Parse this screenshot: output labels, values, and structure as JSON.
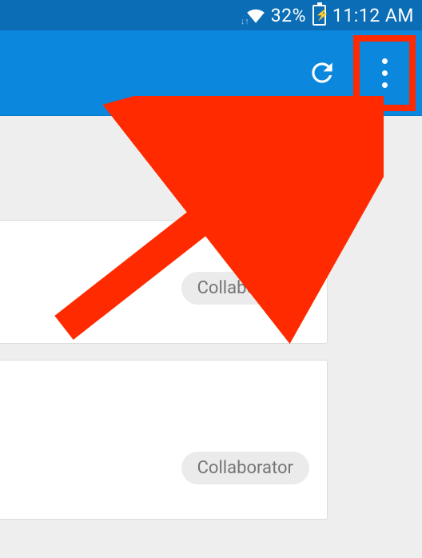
{
  "statusBar": {
    "batteryPercent": "32%",
    "time": "11:12 AM"
  },
  "cards": [
    {
      "badge": "Collaborator"
    },
    {
      "badge": "Collaborator"
    }
  ],
  "highlightColor": "#ff2a00"
}
